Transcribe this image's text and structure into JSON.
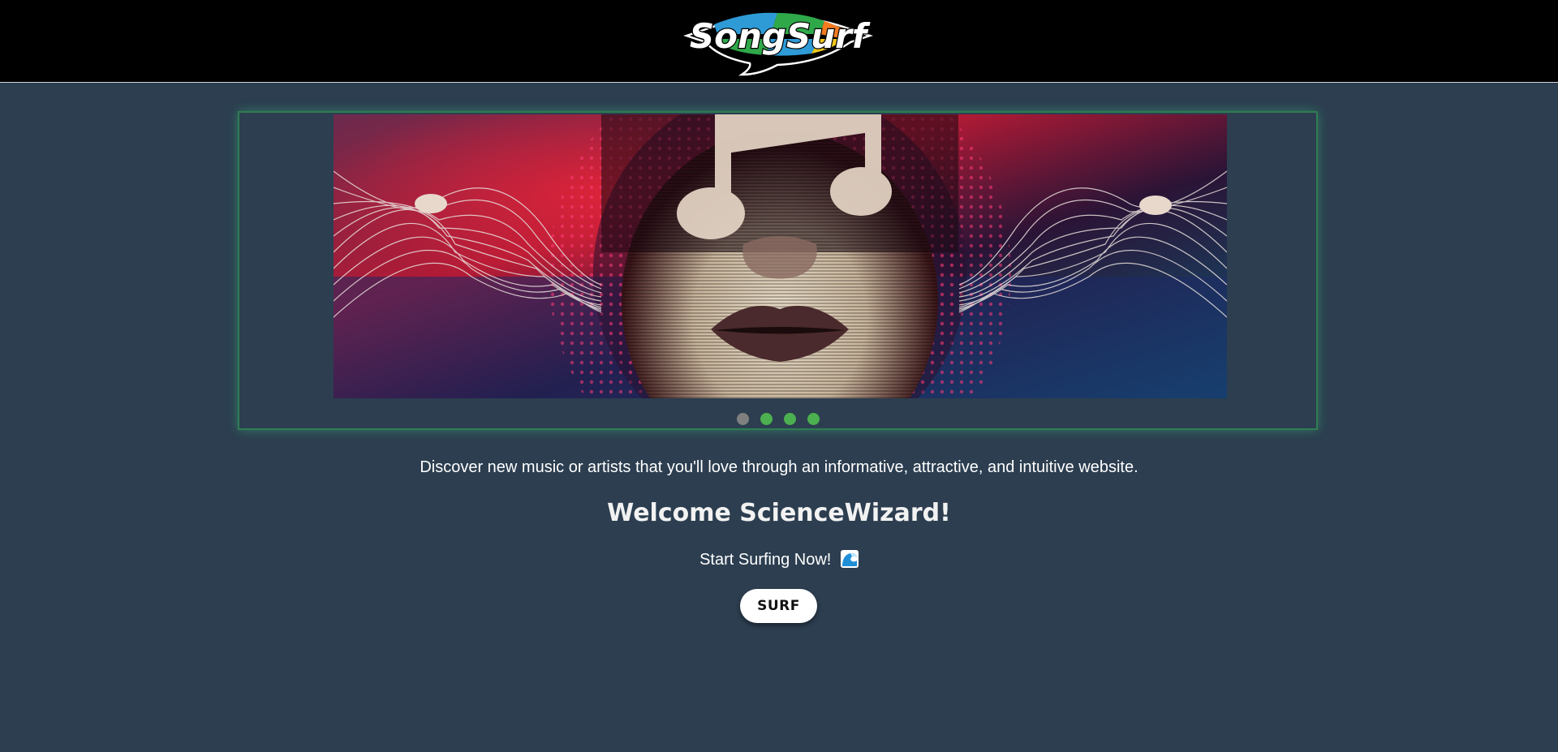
{
  "header": {
    "logo_text": "SongSurf"
  },
  "carousel": {
    "active_index": 0,
    "dots": [
      {
        "label": "slide-1",
        "color": "#808080"
      },
      {
        "label": "slide-2",
        "color": "#4caf50"
      },
      {
        "label": "slide-3",
        "color": "#4caf50"
      },
      {
        "label": "slide-4",
        "color": "#4caf50"
      }
    ],
    "frame_color": "#2f7d52"
  },
  "main": {
    "tagline": "Discover new music or artists that you'll love through an informative, attractive, and intuitive website.",
    "welcome": "Welcome ScienceWizard!",
    "start_text": "Start Surfing Now!",
    "start_icon": "wave-emoji-icon",
    "surf_button": "SURF"
  },
  "colors": {
    "background": "#2c3e50",
    "header": "#000000",
    "accent": "#4caf50"
  }
}
